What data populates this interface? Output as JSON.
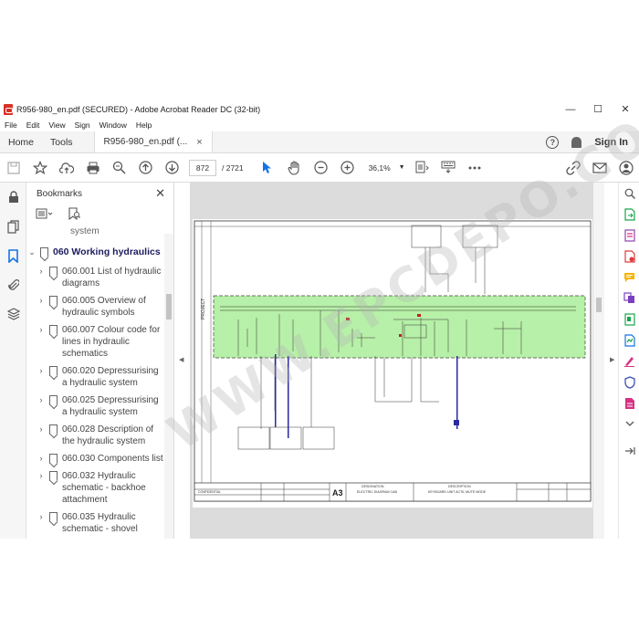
{
  "window": {
    "title": "R956-980_en.pdf (SECURED) - Adobe Acrobat Reader DC (32-bit)",
    "minimize": "—",
    "maximize": "☐",
    "close": "✕"
  },
  "menu": [
    "File",
    "Edit",
    "View",
    "Sign",
    "Window",
    "Help"
  ],
  "tabs": {
    "home": "Home",
    "tools": "Tools",
    "document": "R956-980_en.pdf (...",
    "close": "×",
    "help": "?",
    "signin": "Sign In"
  },
  "toolbar": {
    "page_current": "872",
    "page_total": "/ 2721",
    "zoom": "36,1%"
  },
  "bookmarks": {
    "title": "Bookmarks",
    "close": "✕",
    "partial_top": "system",
    "items": [
      {
        "label": "060 Working hydraulics",
        "expanded": true
      },
      {
        "label": "060.001 List of hydraulic diagrams"
      },
      {
        "label": "060.005 Overview of hydraulic symbols"
      },
      {
        "label": "060.007 Colour code for lines in hydraulic schematics"
      },
      {
        "label": "060.020 Depressurising a hydraulic system"
      },
      {
        "label": "060.025 Depressurising a hydraulic system"
      },
      {
        "label": "060.028 Description of the hydraulic system"
      },
      {
        "label": "060.030 Components list"
      },
      {
        "label": "060.032 Hydraulic schematic - backhoe attachment"
      },
      {
        "label": "060.035 Hydraulic schematic - shovel"
      }
    ]
  },
  "diagram": {
    "sheet_size": "A3",
    "designation": "DESIGNATION",
    "designation_value": "ELECTRIC DIAGRAM CAB",
    "description": "DESCRIPTION",
    "description_value": "KEYBOARD UNIT ACTIL MUTE MODE",
    "project_label": "PROJECT",
    "confidential": "CONFIDENTIAL"
  },
  "watermark": "WWW.EPCDEPO.COM",
  "colors": {
    "accent": "#1473e6",
    "highlight": "#b7f0a8"
  },
  "right_rail_icons": [
    {
      "name": "zoom-icon",
      "color": "#555555"
    },
    {
      "name": "export-pdf-icon",
      "color": "#1aa34a"
    },
    {
      "name": "create-pdf-icon",
      "color": "#8e44ad"
    },
    {
      "name": "edit-pdf-icon",
      "color": "#e03a3a"
    },
    {
      "name": "comment-icon",
      "color": "#f5b400"
    },
    {
      "name": "combine-icon",
      "color": "#7b3fbf"
    },
    {
      "name": "organize-icon",
      "color": "#1aa34a"
    },
    {
      "name": "scan-icon",
      "color": "#1473e6"
    },
    {
      "name": "fill-sign-icon",
      "color": "#d63384"
    },
    {
      "name": "protect-icon",
      "color": "#3f51b5"
    },
    {
      "name": "more-tools-icon",
      "color": "#d63384"
    },
    {
      "name": "expand-icon",
      "color": "#555555"
    }
  ]
}
